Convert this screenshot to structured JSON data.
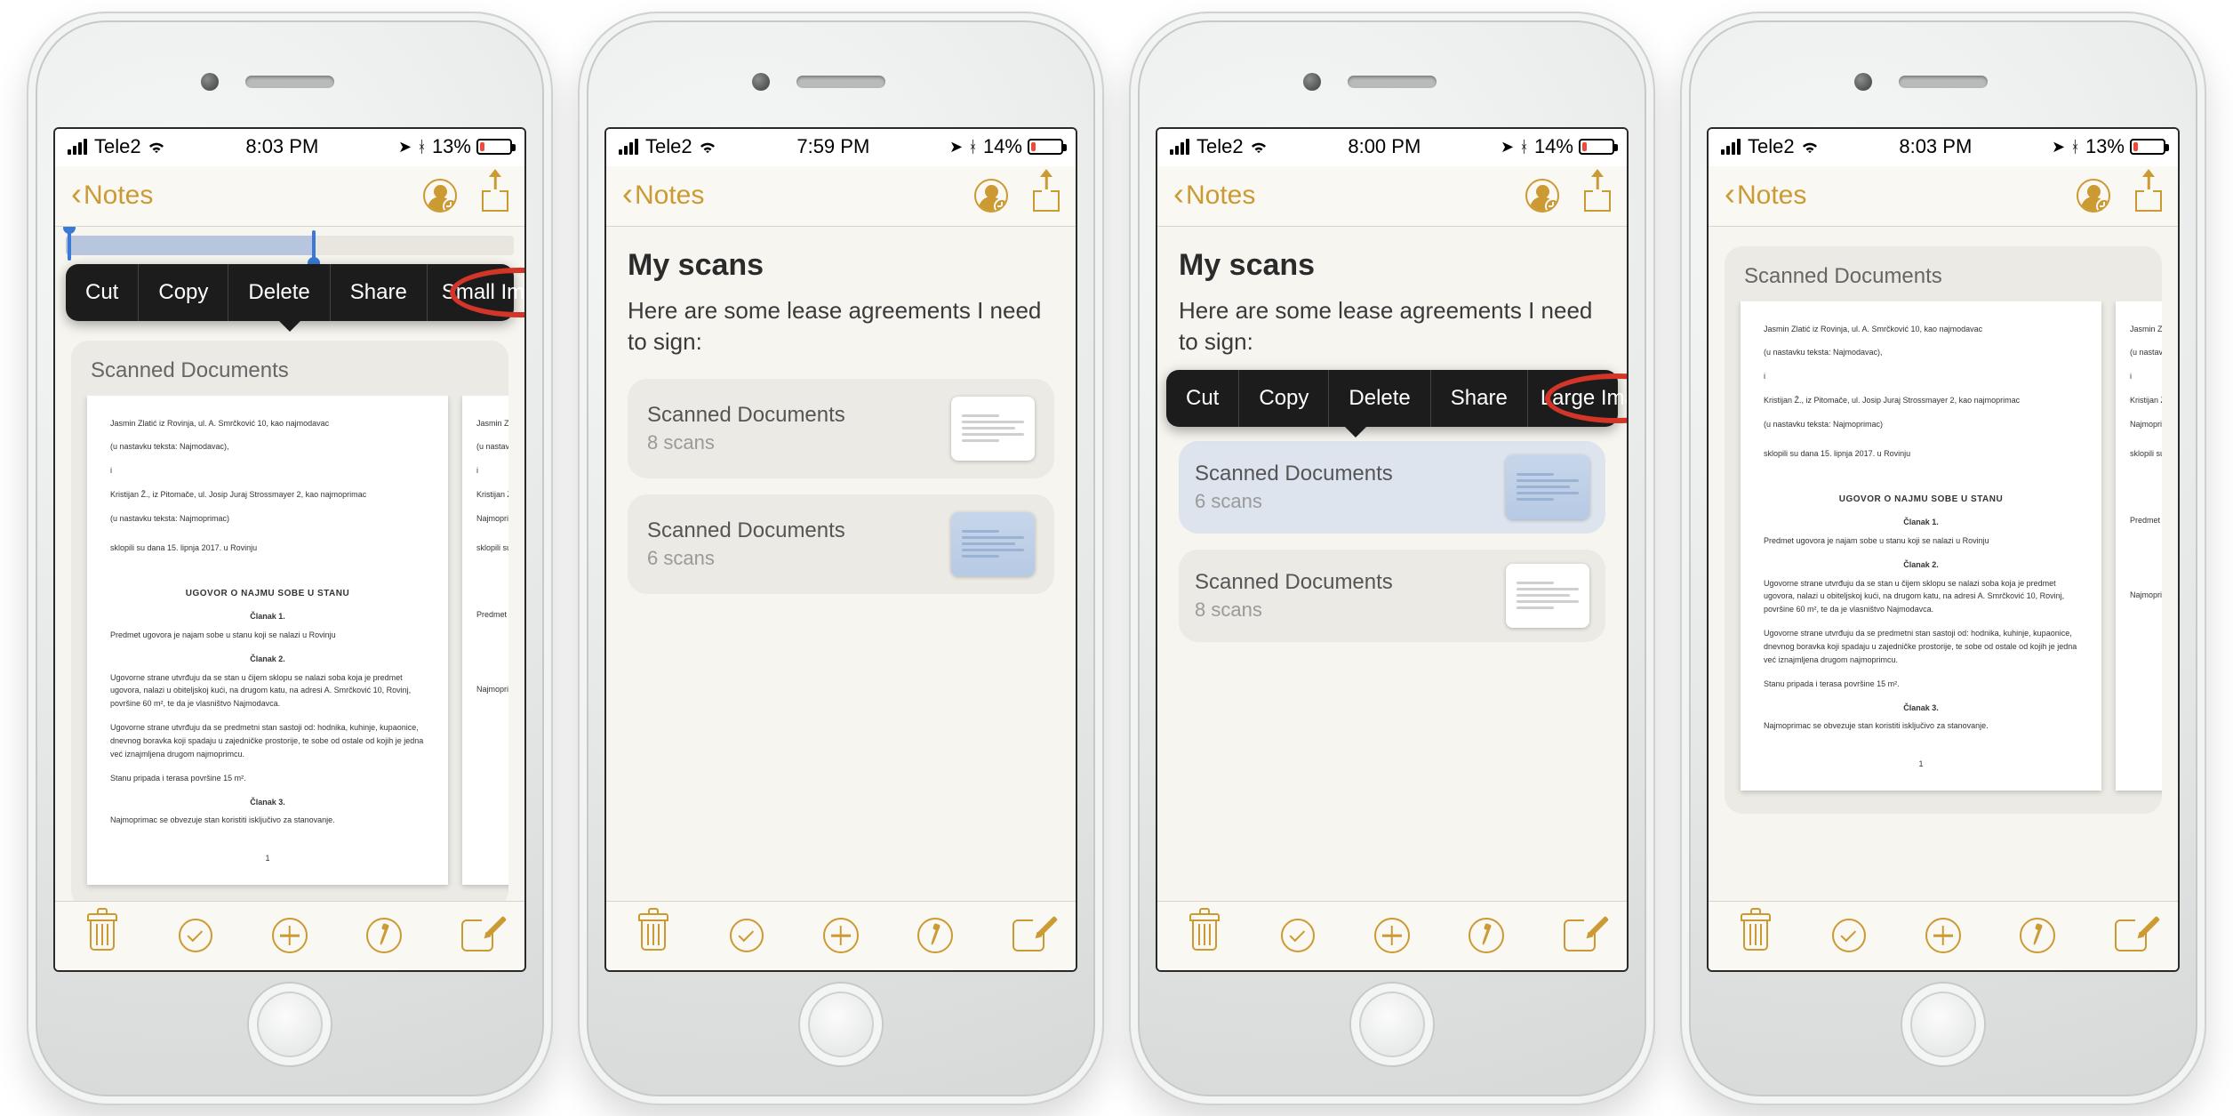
{
  "phones": [
    {
      "status": {
        "carrier": "Tele2",
        "time": "8:03 PM",
        "battery_pct": "13%"
      },
      "nav_back": "Notes",
      "attachment_header": "Scanned Documents",
      "context_menu": [
        "Cut",
        "Copy",
        "Delete",
        "Share",
        "Small Images"
      ]
    },
    {
      "status": {
        "carrier": "Tele2",
        "time": "7:59 PM",
        "battery_pct": "14%"
      },
      "nav_back": "Notes",
      "title": "My scans",
      "body": "Here are some lease agreements I need to sign:",
      "cards": [
        {
          "title": "Scanned Documents",
          "sub": "8 scans",
          "blue": false
        },
        {
          "title": "Scanned Documents",
          "sub": "6 scans",
          "blue": true
        }
      ]
    },
    {
      "status": {
        "carrier": "Tele2",
        "time": "8:00 PM",
        "battery_pct": "14%"
      },
      "nav_back": "Notes",
      "title": "My scans",
      "body": "Here are some lease agreements I need to sign:",
      "context_menu": [
        "Cut",
        "Copy",
        "Delete",
        "Share",
        "Large Images"
      ],
      "cards": [
        {
          "title": "Scanned Documents",
          "sub": "6 scans",
          "blue": true
        },
        {
          "title": "Scanned Documents",
          "sub": "8 scans",
          "blue": false
        }
      ]
    },
    {
      "status": {
        "carrier": "Tele2",
        "time": "8:03 PM",
        "battery_pct": "13%"
      },
      "nav_back": "Notes",
      "attachment_header": "Scanned Documents"
    }
  ],
  "doc": {
    "l1": "Jasmin Zlatić iz Rovinja, ul. A. Smrčković 10, kao najmodavac",
    "l2": "(u nastavku teksta: Najmodavac),",
    "l3": "i",
    "l4": "Kristijan Ž., iz Pitomače, ul. Josip Juraj Strossmayer 2, kao najmoprimac",
    "l5": "(u nastavku teksta: Najmoprimac)",
    "l6": "sklopili su dana 15. lipnja 2017. u Rovinju",
    "title": "UGOVOR O NAJMU SOBE U STANU",
    "c1": "Članak 1.",
    "p1": "Predmet ugovora je najam sobe u stanu koji se nalazi u Rovinju",
    "c2": "Članak 2.",
    "p2": "Ugovorne strane utvrđuju da se stan u čijem sklopu se nalazi soba koja je predmet ugovora, nalazi u obiteljskoj kući, na drugom katu, na adresi A. Smrčković 10, Rovinj, površine 60 m², te da je vlasništvo Najmodavca.",
    "p3": "Ugovorne strane utvrđuju da se predmetni stan sastoji od: hodnika, kuhinje, kupaonice, dnevnog boravka koji spadaju u zajedničke prostorije, te sobe od ostale od kojih je jedna već iznajmljena drugom najmoprimcu.",
    "p4": "Stanu pripada i terasa površine 15 m².",
    "c3": "Članak 3.",
    "p5": "Najmoprimac se obvezuje stan koristiti isključivo za stanovanje.",
    "dot": "1"
  },
  "icons": {
    "location": "➤",
    "bluetooth": "∦",
    "wifi": "wifi"
  }
}
